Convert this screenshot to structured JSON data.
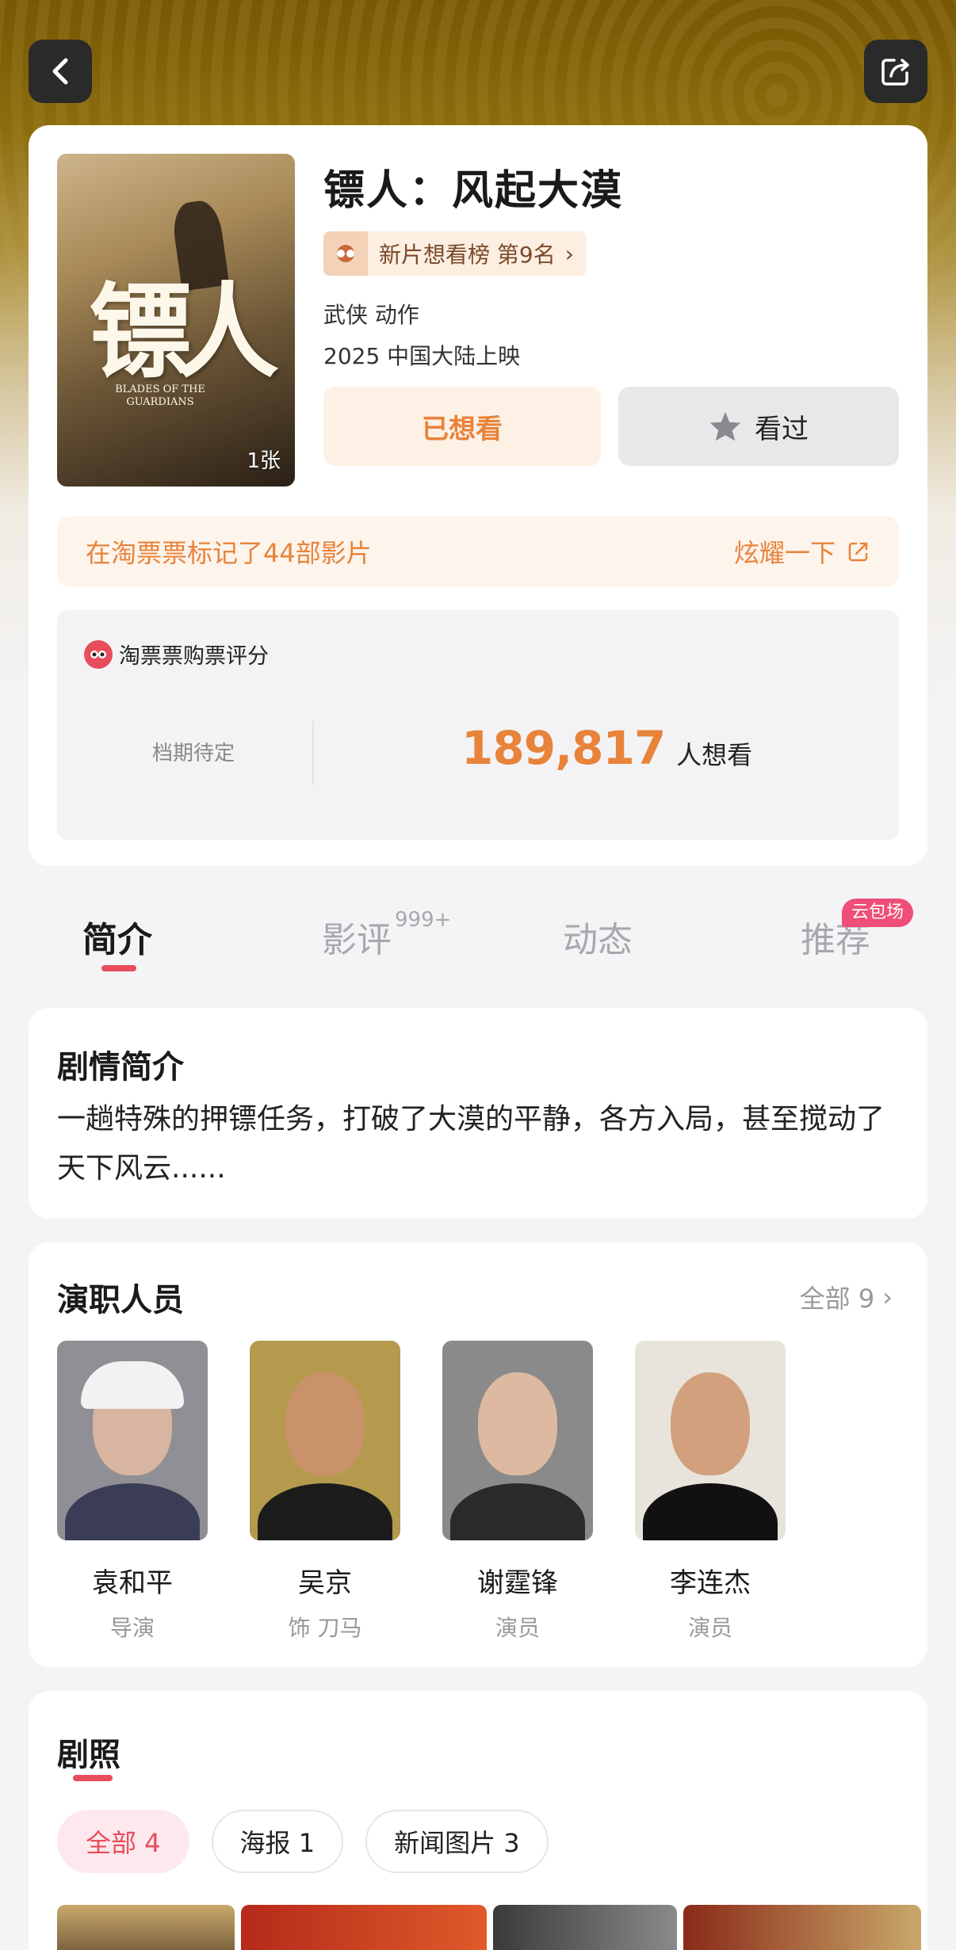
{
  "header": {
    "back_icon": "chevron-left-icon",
    "share_icon": "share-icon"
  },
  "movie": {
    "poster_title": "镖人",
    "poster_subtitle": "BLADES OF THE GUARDIANS",
    "poster_count": "1张",
    "title": "镖人：风起大漠",
    "rank": "新片想看榜 第9名",
    "genre": "武侠 动作",
    "release": "2025 中国大陆上映",
    "want_label": "已想看",
    "seen_label": "看过"
  },
  "mark_banner": {
    "text": "在淘票票标记了44部影片",
    "flaunt": "炫耀一下"
  },
  "rating": {
    "title": "淘票票购票评分",
    "pending": "档期待定",
    "want_count": "189,817",
    "want_label": "人想看"
  },
  "tabs": {
    "intro": "简介",
    "review": "影评",
    "review_count": "999+",
    "feed": "动态",
    "rec": "推荐",
    "rec_badge": "云包场"
  },
  "synopsis": {
    "title": "剧情简介",
    "text": "一趟特殊的押镖任务，打破了大漠的平静，各方入局，甚至搅动了天下风云......"
  },
  "cast": {
    "title": "演职人员",
    "all_label": "全部 9",
    "members": [
      {
        "name": "袁和平",
        "role": "导演"
      },
      {
        "name": "吴京",
        "role": "饰 刀马"
      },
      {
        "name": "谢霆锋",
        "role": "演员"
      },
      {
        "name": "李连杰",
        "role": "演员"
      }
    ]
  },
  "stills": {
    "title": "剧照",
    "filters": [
      {
        "label": "全部 4"
      },
      {
        "label": "海报 1"
      },
      {
        "label": "新闻图片 3"
      }
    ]
  },
  "colors": {
    "accent_orange": "#e8833a",
    "accent_pink": "#e84d5b",
    "hero_gold": "#8a6a0c"
  }
}
